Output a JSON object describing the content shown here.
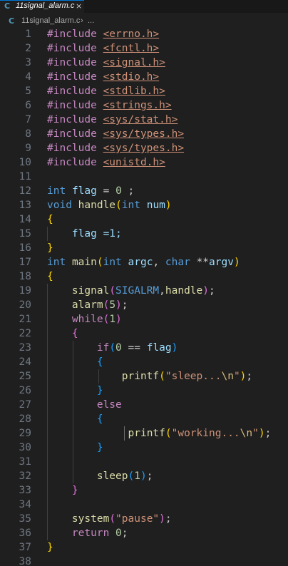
{
  "tab": {
    "title": "11signal_alarm.c",
    "close": "×",
    "icon": "C"
  },
  "breadcrumb": {
    "file": "11signal_alarm.c",
    "sep": "›",
    "more": "..."
  },
  "line_numbers": [
    "1",
    "2",
    "3",
    "4",
    "5",
    "6",
    "7",
    "8",
    "9",
    "10",
    "11",
    "12",
    "13",
    "14",
    "15",
    "16",
    "17",
    "18",
    "19",
    "20",
    "21",
    "22",
    "23",
    "24",
    "25",
    "26",
    "27",
    "28",
    "29",
    "30",
    "31",
    "32",
    "33",
    "34",
    "35",
    "36",
    "37",
    "38"
  ],
  "code": {
    "include": "#include",
    "headers": [
      "<errno.h>",
      "<fcntl.h>",
      "<signal.h>",
      "<stdio.h>",
      "<stdlib.h>",
      "<strings.h>",
      "<sys/stat.h>",
      "<sys/types.h>",
      "<sys/types.h>",
      "<unistd.h>"
    ],
    "int": "int",
    "void": "void",
    "char": "char",
    "flag": "flag",
    "eq": "=",
    "zero": "0",
    "one": "1",
    "five": "5",
    "semi": ";",
    "handle": "handle",
    "num": "num",
    "flag_assign": "flag =1;",
    "main": "main",
    "argc": "argc",
    "argv": "argv",
    "stars": "**",
    "comma": ",",
    "signal": "signal",
    "SIGALRM": "SIGALRM",
    "alarm": "alarm",
    "while": "while",
    "if": "if",
    "eqeq": "==",
    "printf": "printf",
    "str_sleep": "\"sleep...",
    "str_working": "\"working...",
    "newline": "\\n",
    "quote": "\"",
    "else": "else",
    "sleep": "sleep",
    "system": "system",
    "str_pause": "\"pause\"",
    "return": "return",
    "lparen": "(",
    "rparen": ")",
    "lbrace": "{",
    "rbrace": "}"
  },
  "colors": {
    "background": "#1f1f1f",
    "keyword": "#c586c0",
    "type": "#569cd6",
    "string": "#ce9178",
    "function": "#dcdcaa",
    "variable": "#9cdcfe",
    "number": "#b5cea8",
    "bracket1": "#ffd700",
    "bracket2": "#da70d6",
    "bracket3": "#179fff"
  }
}
